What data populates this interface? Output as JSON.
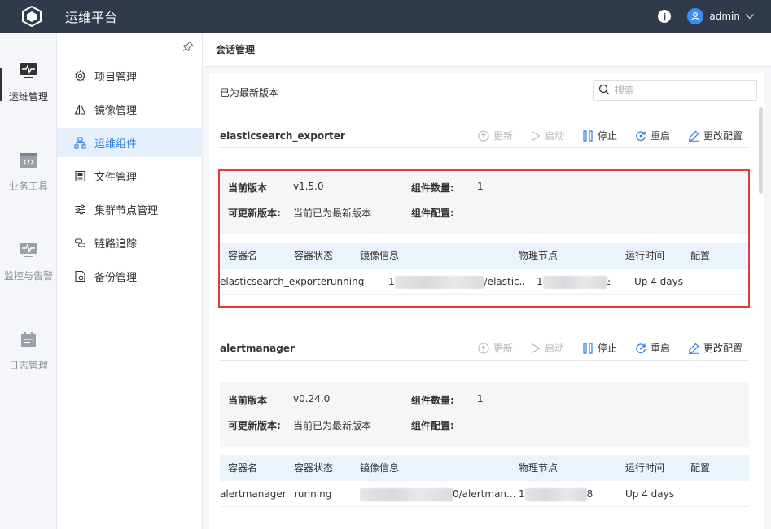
{
  "header": {
    "title": "运维平台",
    "info_icon": "i",
    "user": "admin"
  },
  "rail": {
    "items": [
      {
        "label": "运维管理",
        "icon": "monitor-pulse-icon",
        "active": true
      },
      {
        "label": "业务工具",
        "icon": "code-window-icon",
        "active": false
      },
      {
        "label": "监控与告警",
        "icon": "monitor-alert-icon",
        "active": false
      },
      {
        "label": "日志管理",
        "icon": "calendar-log-icon",
        "active": false
      }
    ]
  },
  "submenu": {
    "items": [
      {
        "label": "项目管理",
        "icon": "gear-icon"
      },
      {
        "label": "镜像管理",
        "icon": "mirror-icon"
      },
      {
        "label": "运维组件",
        "icon": "components-icon",
        "active": true
      },
      {
        "label": "文件管理",
        "icon": "file-icon"
      },
      {
        "label": "集群节点管理",
        "icon": "sliders-icon"
      },
      {
        "label": "链路追踪",
        "icon": "link-icon"
      },
      {
        "label": "备份管理",
        "icon": "backup-icon"
      }
    ]
  },
  "page": {
    "title": "会话管理",
    "status": "已为最新版本",
    "search_placeholder": "搜索"
  },
  "actions": {
    "update": "更新",
    "start": "启动",
    "stop": "停止",
    "restart": "重启",
    "config": "更改配置"
  },
  "labels": {
    "current_version": "当前版本",
    "updatable_version": "可更新版本:",
    "component_count": "组件数量:",
    "component_config": "组件配置:"
  },
  "table_columns": [
    "容器名",
    "容器状态",
    "镜像信息",
    "物理节点",
    "运行时间",
    "配置"
  ],
  "components": [
    {
      "name": "elasticsearch_exporter",
      "current_version": "v1.5.0",
      "updatable_version": "当前已为最新版本",
      "count": "1",
      "config": "",
      "row": {
        "container": "elasticsearch_exporter",
        "status": "running",
        "image_prefix": "1",
        "image_suffix": "/elastic...",
        "node_prefix": "1",
        "node_suffix": "3",
        "uptime": "Up 4 days"
      }
    },
    {
      "name": "alertmanager",
      "current_version": "v0.24.0",
      "updatable_version": "当前已为最新版本",
      "count": "1",
      "config": "",
      "row": {
        "container": "alertmanager",
        "status": "running",
        "image_prefix": "",
        "image_suffix": "0/alertman...",
        "node_prefix": "1",
        "node_suffix": "8",
        "uptime": "Up 4 days"
      }
    }
  ]
}
